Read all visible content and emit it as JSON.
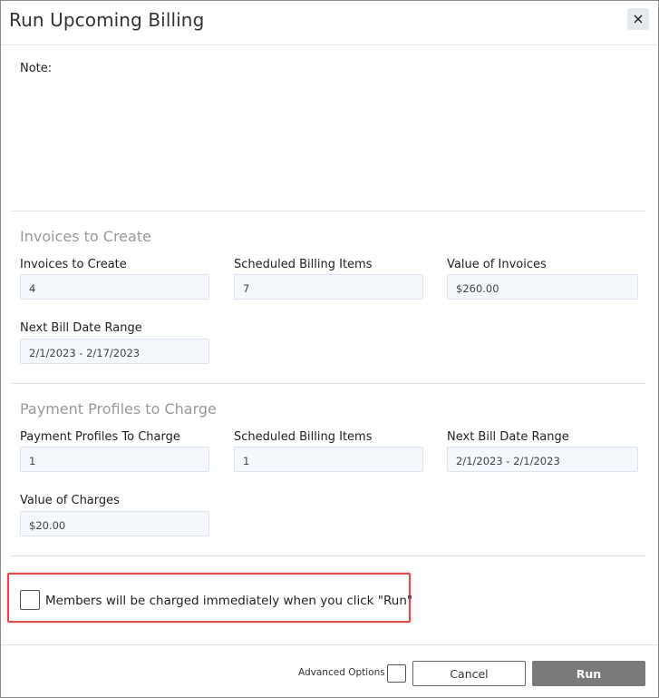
{
  "dialog": {
    "title": "Run Upcoming Billing",
    "close_icon": "close-icon"
  },
  "note": {
    "label": "Note:"
  },
  "invoices": {
    "section_title": "Invoices to Create",
    "fields": [
      {
        "label": "Invoices to Create",
        "value": "4"
      },
      {
        "label": "Scheduled Billing Items",
        "value": "7"
      },
      {
        "label": "Value of Invoices",
        "value": "$260.00"
      },
      {
        "label": "Next Bill Date Range",
        "value": "2/1/2023 - 2/17/2023"
      }
    ]
  },
  "payments": {
    "section_title": "Payment Profiles to Charge",
    "fields": [
      {
        "label": "Payment Profiles To Charge",
        "value": "1"
      },
      {
        "label": "Scheduled Billing Items",
        "value": "1"
      },
      {
        "label": "Next Bill Date Range",
        "value": "2/1/2023 - 2/1/2023"
      },
      {
        "label": "Value of Charges",
        "value": "$20.00"
      }
    ]
  },
  "confirm": {
    "text": "Members will be charged immediately when you click \"Run\"",
    "checked": false
  },
  "footer": {
    "advanced_options_label": "Advanced Options",
    "cancel_label": "Cancel",
    "run_label": "Run"
  },
  "colors": {
    "highlight_border": "#e04a4a",
    "run_button_bg": "#7a7a7a",
    "field_bg": "#f4f8fc"
  }
}
